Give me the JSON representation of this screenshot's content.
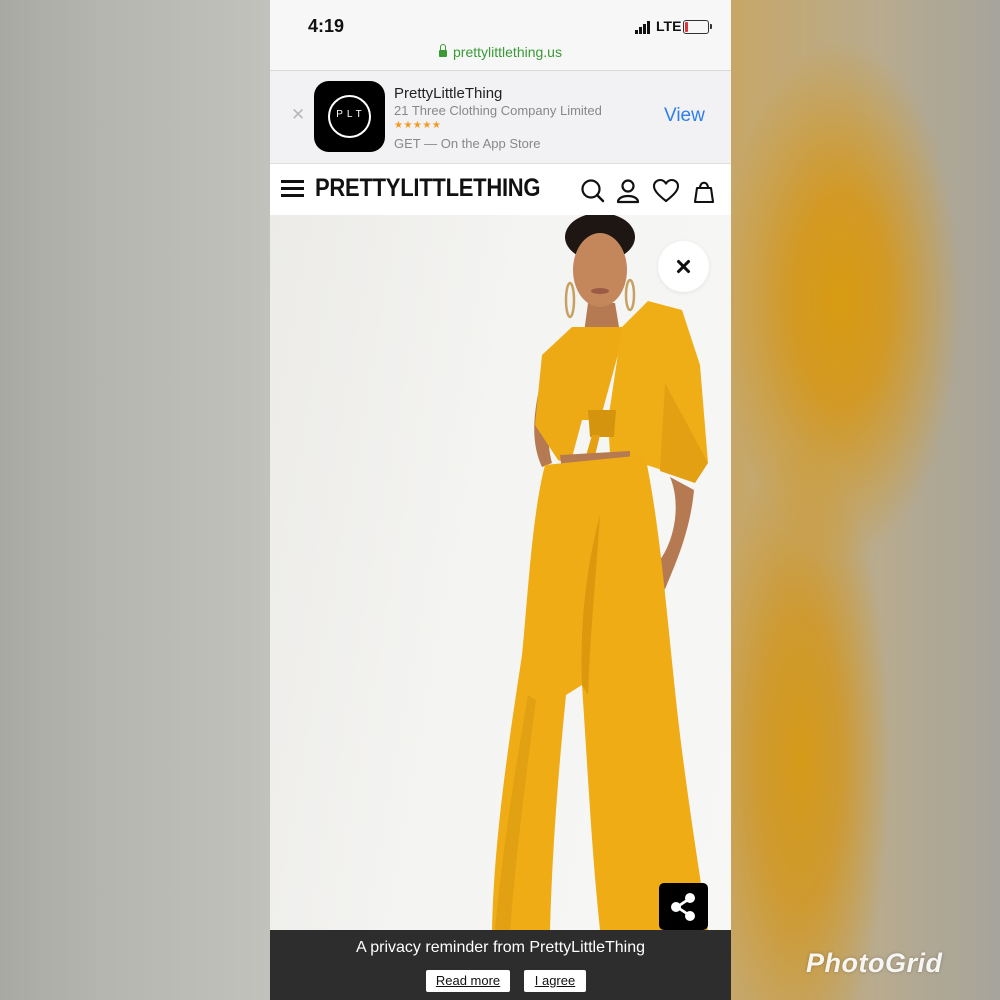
{
  "status_bar": {
    "time": "4:19",
    "network": "LTE",
    "battery_level": 0.15
  },
  "browser": {
    "url": "prettylittlething.us"
  },
  "app_banner": {
    "icon_text": "PLT",
    "app_name": "PrettyLittleThing",
    "company": "21 Three Clothing Company Limited",
    "stars": "★★★★★",
    "get_text": "GET — On the App Store",
    "view_label": "View",
    "accent_color": "#2f7fe8"
  },
  "site_header": {
    "logo_text": "PRETTYLITTLETHING"
  },
  "privacy_bar": {
    "message": "A privacy reminder from PrettyLittleThing",
    "read_more_label": "Read more",
    "agree_label": "I agree"
  },
  "watermark": "PhotoGrid"
}
